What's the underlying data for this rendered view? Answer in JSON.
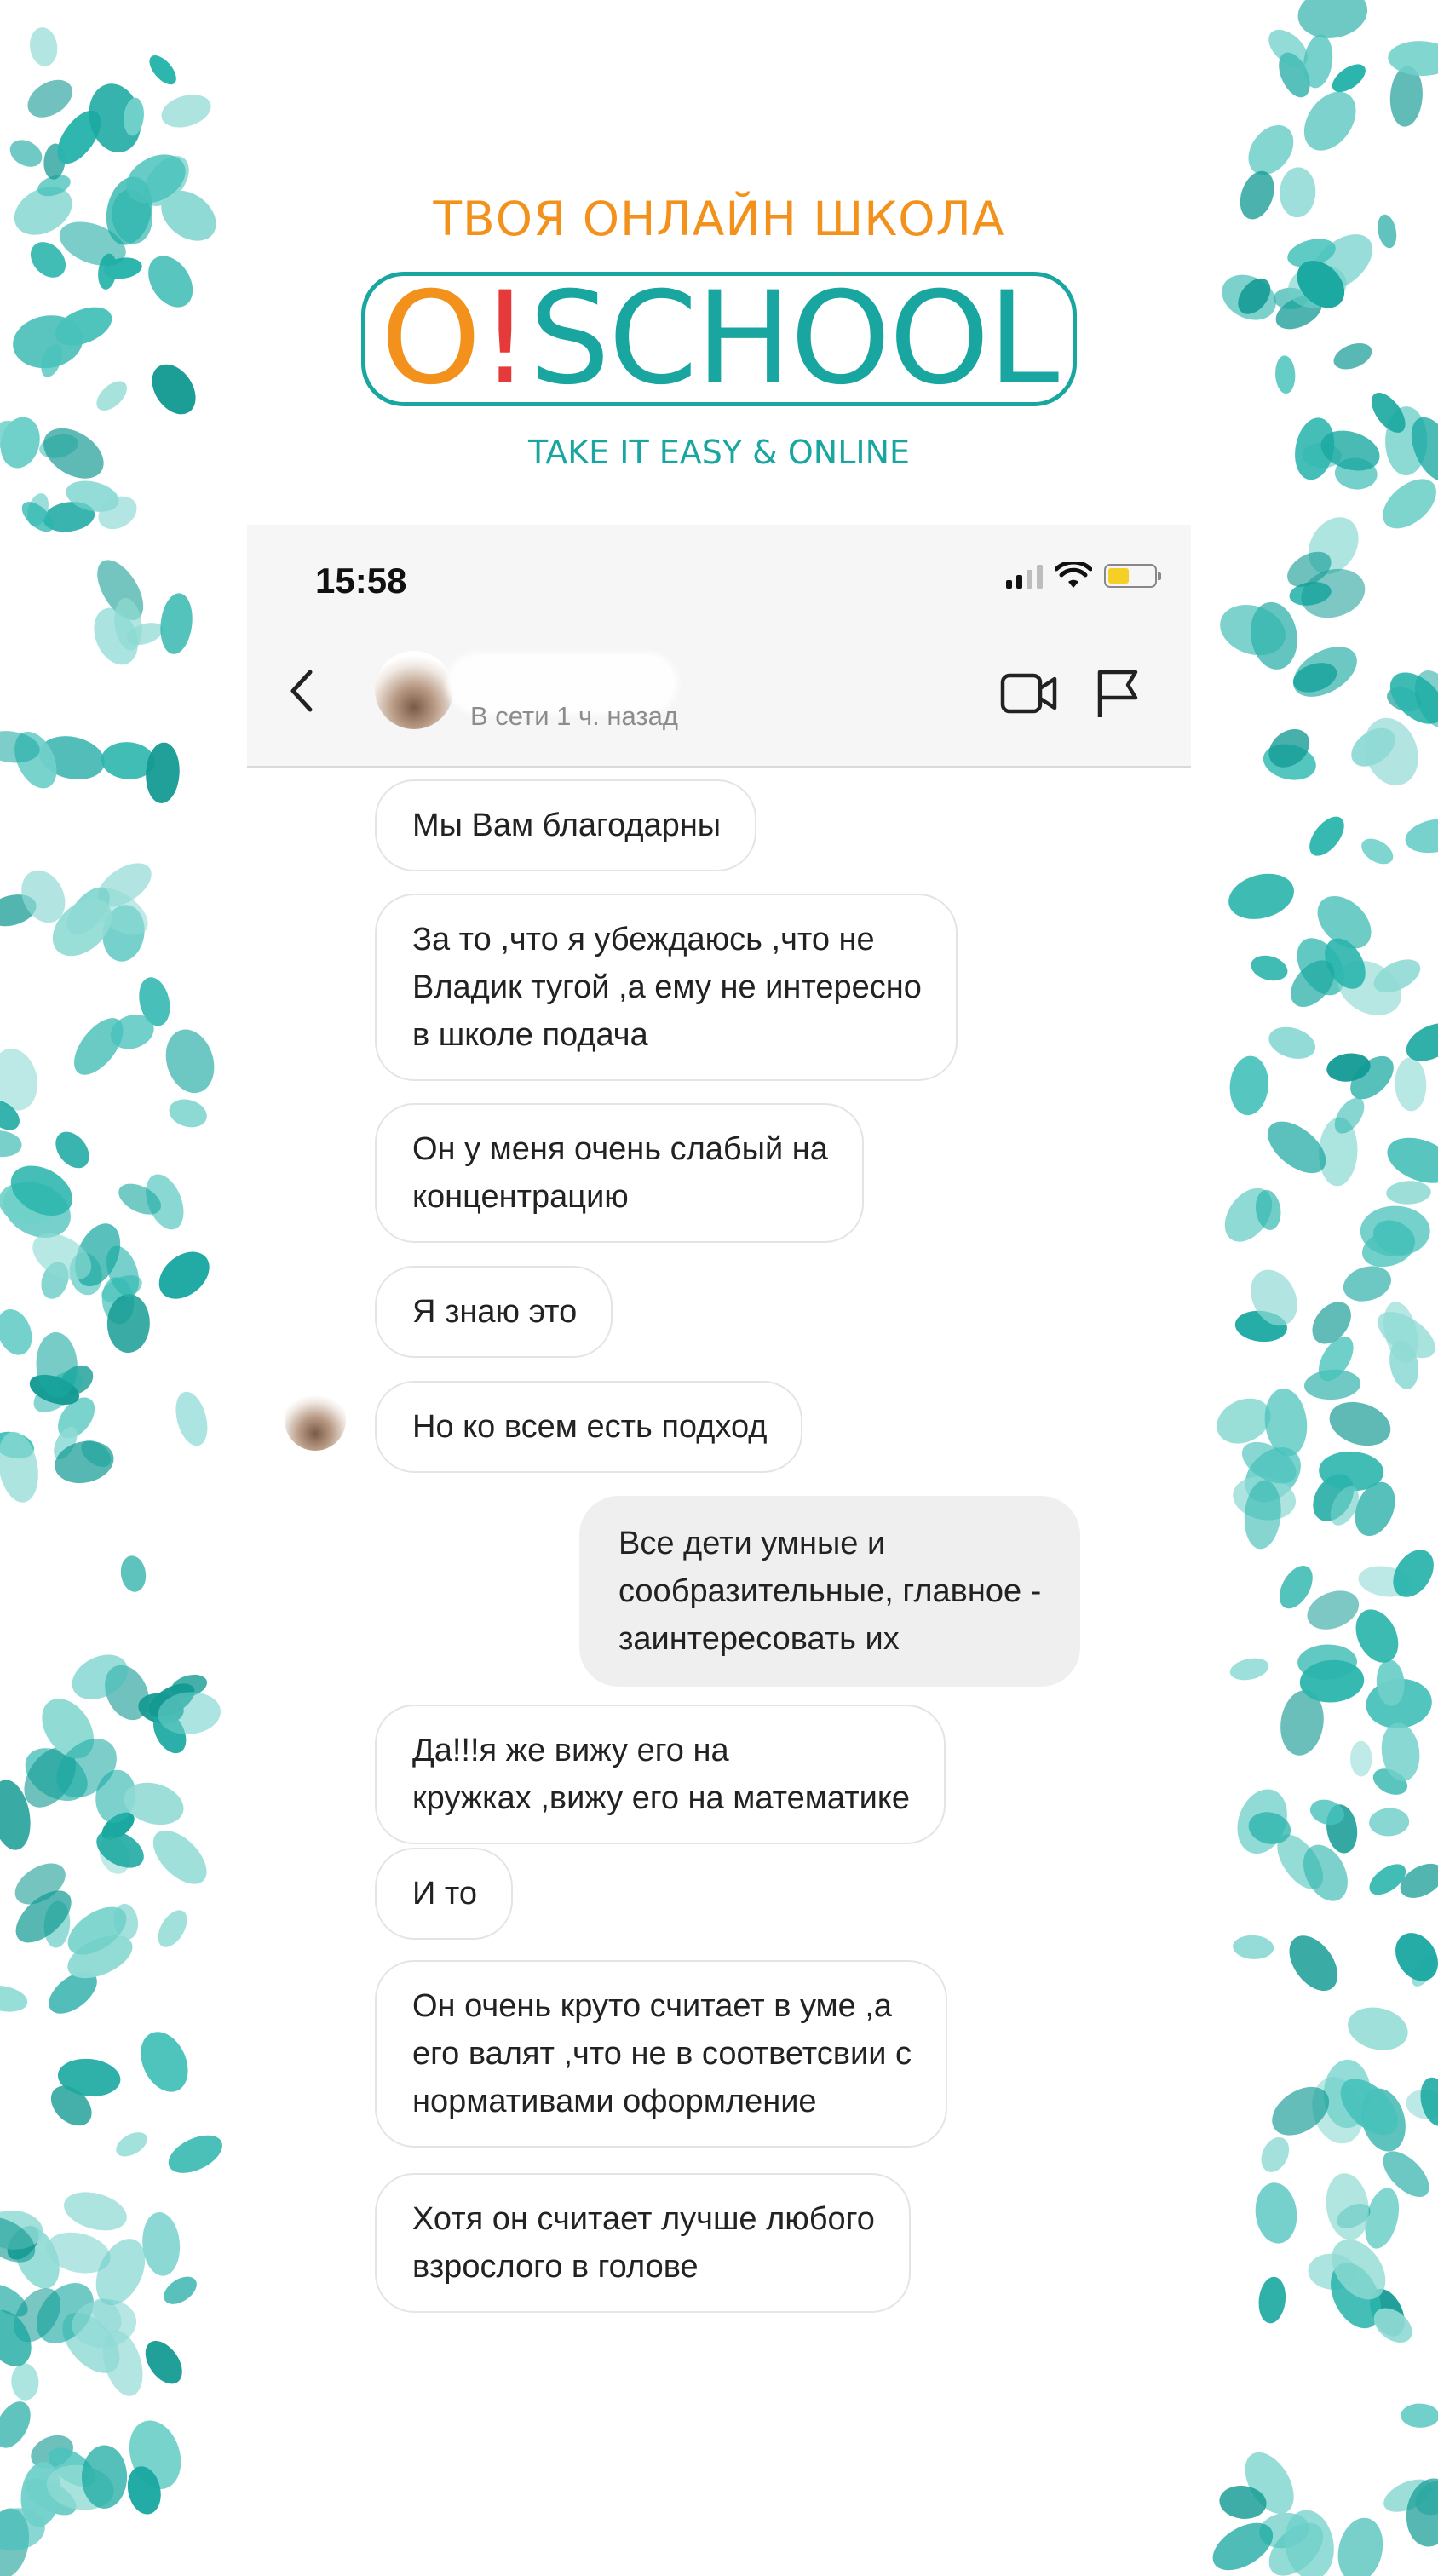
{
  "brand": {
    "tagline_top": "ТВОЯ ОНЛАЙН ШКОЛА",
    "logo_o": "O",
    "logo_excl": "!",
    "logo_school": "SCHOOL",
    "tagline_bottom": "TAKE IT EASY & ONLINE",
    "colors": {
      "teal": "#19a6a0",
      "orange": "#f2921c",
      "red": "#e53a39"
    }
  },
  "status_bar": {
    "time": "15:58",
    "icons": [
      "cellular-signal-icon",
      "wifi-icon",
      "battery-icon"
    ],
    "battery_level": 0.45,
    "battery_color": "#f5cf25"
  },
  "chat_header": {
    "contact_status": "В сети 1 ч. назад",
    "icons": [
      "back-arrow-icon",
      "video-call-icon",
      "flag-icon"
    ]
  },
  "messages": [
    {
      "direction": "in",
      "text": "Мы Вам благодарны"
    },
    {
      "direction": "in",
      "text": "За то ,что я убеждаюсь ,что не\nВладик тугой ,а ему не интересно\nв школе подача"
    },
    {
      "direction": "in",
      "text": "Он у меня очень слабый на\nконцентрацию"
    },
    {
      "direction": "in",
      "text": "Я знаю это"
    },
    {
      "direction": "in",
      "text": "Но ко всем есть подход"
    },
    {
      "direction": "out",
      "text": "Все дети умные и\nсообразительные, главное -\nзаинтересовать их"
    },
    {
      "direction": "in",
      "text": "Да!!!я же вижу его на\nкружках ,вижу его на математике"
    },
    {
      "direction": "in",
      "text": "И то"
    },
    {
      "direction": "in",
      "text": "Он очень круто считает в уме ,а\nего валят ,что не в соответсвии с\nнормативами оформление"
    },
    {
      "direction": "in",
      "text": "Хотя он считает лучше любого\nвзрослого в голове"
    }
  ]
}
